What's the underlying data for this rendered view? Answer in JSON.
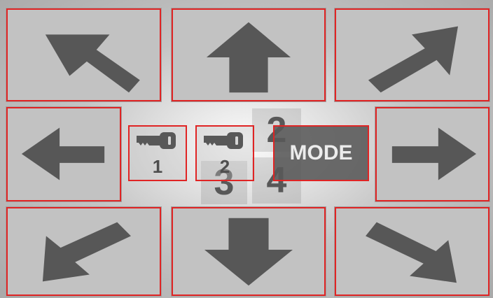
{
  "tiles": {
    "tile_3": "3",
    "tile_2": "2",
    "tile_4": "4"
  },
  "key_buttons": [
    {
      "number": "1"
    },
    {
      "number": "2"
    }
  ],
  "mode_button": {
    "label": "MODE"
  },
  "direction_pads": [
    {
      "direction": "up-left",
      "icon": "arrow-up-left-icon"
    },
    {
      "direction": "up",
      "icon": "arrow-up-icon"
    },
    {
      "direction": "up-right",
      "icon": "arrow-up-right-icon"
    },
    {
      "direction": "left",
      "icon": "arrow-left-icon"
    },
    {
      "direction": "right",
      "icon": "arrow-right-icon"
    },
    {
      "direction": "down-left",
      "icon": "arrow-down-left-icon"
    },
    {
      "direction": "down",
      "icon": "arrow-down-icon"
    },
    {
      "direction": "down-right",
      "icon": "arrow-down-right-icon"
    }
  ],
  "colors": {
    "outline": "#e02424",
    "arrow": "#575757",
    "pad": "#c2c2c2",
    "mode_background": "#585858",
    "mode_text": "#ececec"
  }
}
